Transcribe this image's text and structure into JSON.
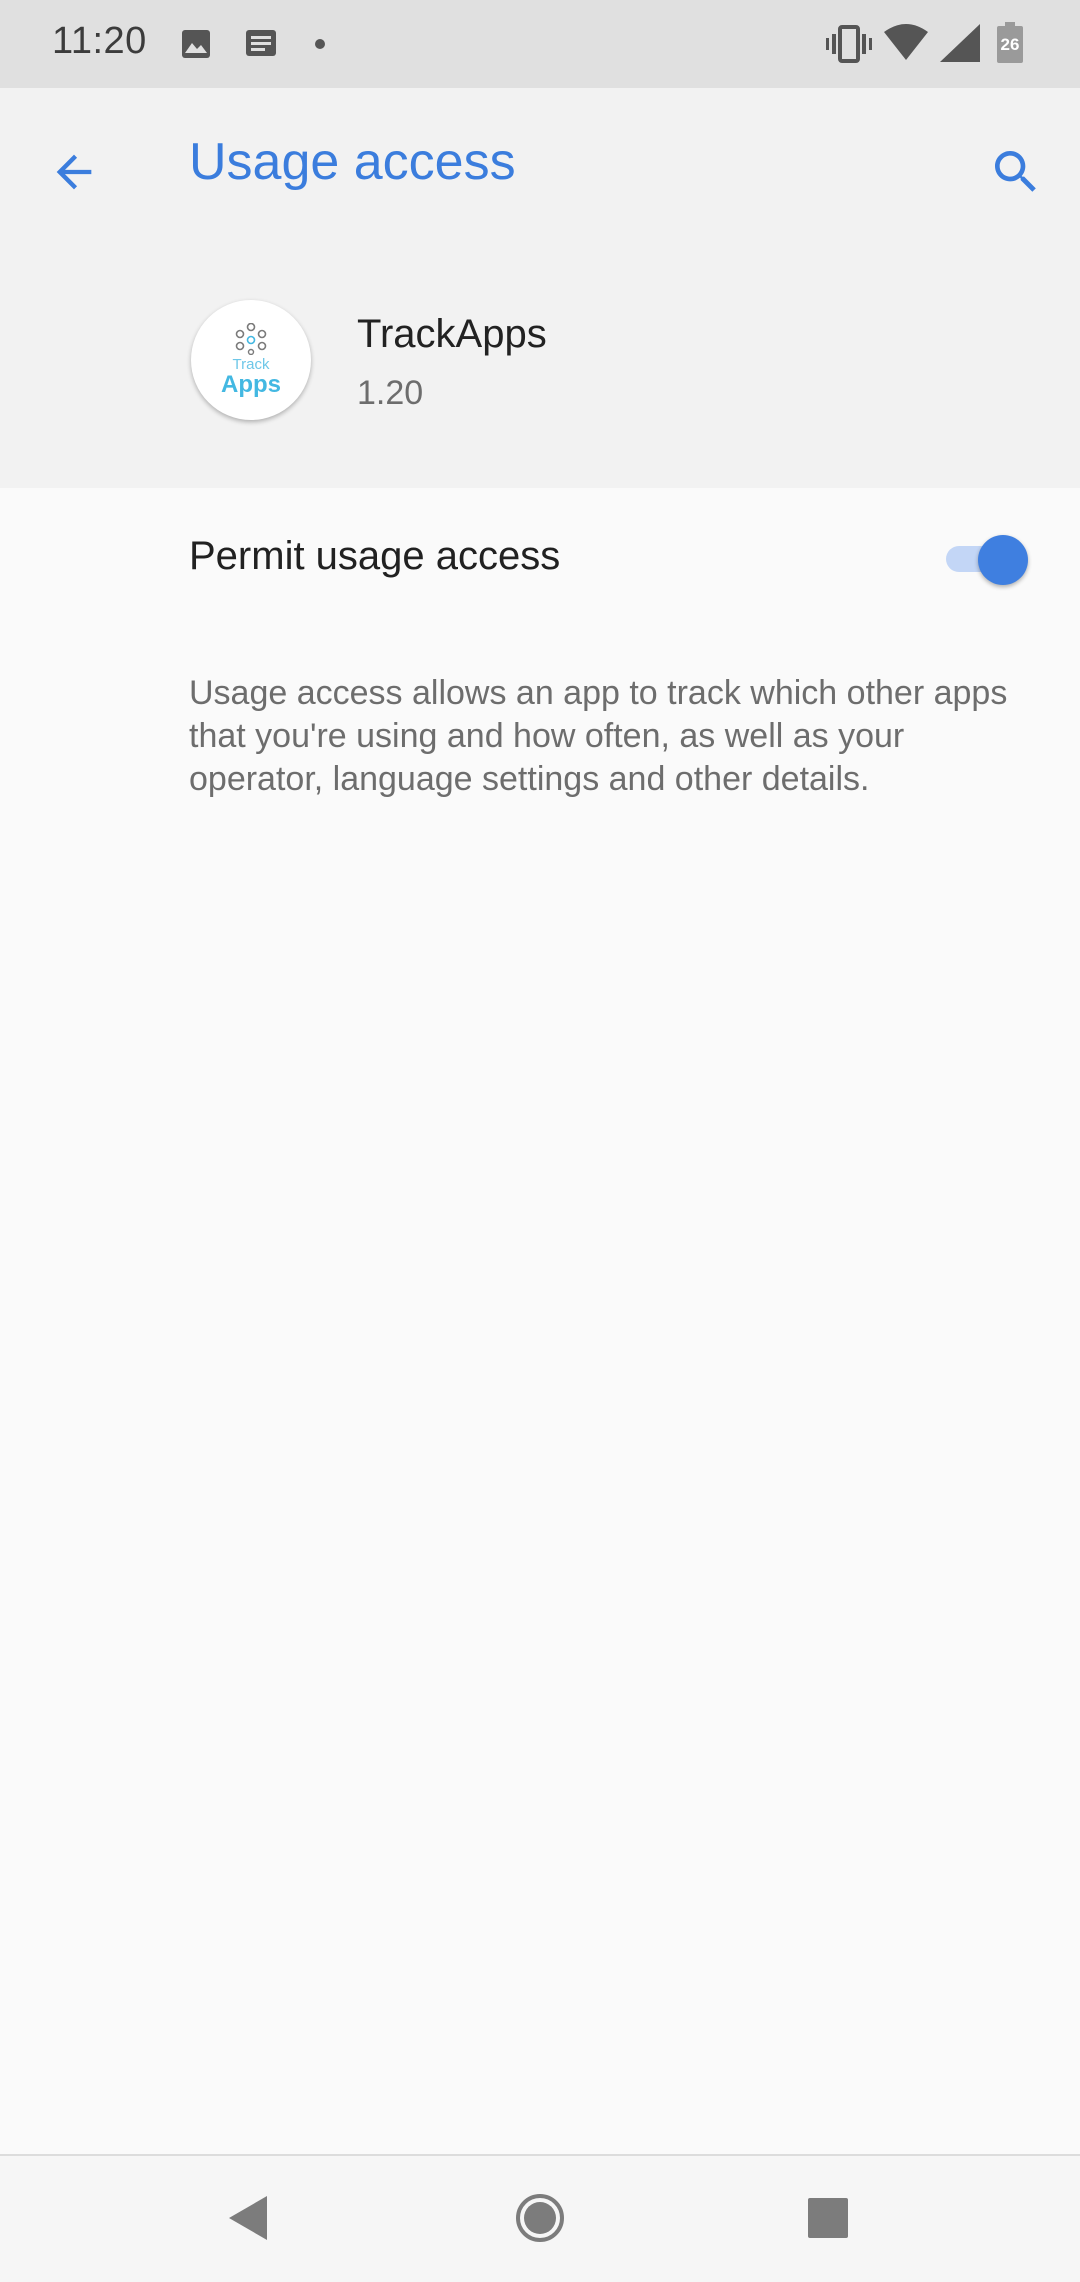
{
  "status_bar": {
    "time": "11:20",
    "battery_level": "26",
    "icons": [
      "image-icon",
      "message-icon",
      "dot-icon",
      "vibrate-icon",
      "wifi-icon",
      "signal-icon",
      "battery-icon"
    ]
  },
  "header": {
    "title": "Usage access",
    "back_icon": "back-arrow-icon",
    "search_icon": "search-icon"
  },
  "app": {
    "name": "TrackApps",
    "version": "1.20",
    "icon_text_top": "Track",
    "icon_text_bottom": "Apps"
  },
  "permission": {
    "label": "Permit usage access",
    "enabled": true,
    "description": "Usage access allows an app to track which other apps that you're using and how often, as well as your operator, language settings and other details."
  },
  "nav_bar": {
    "icons": [
      "back-triangle-icon",
      "home-circle-icon",
      "recents-square-icon"
    ]
  },
  "colors": {
    "accent": "#3b7ddd",
    "status_bar_bg": "#e0e0e0",
    "header_bg": "#f2f2f2",
    "page_bg": "#fafafa"
  }
}
